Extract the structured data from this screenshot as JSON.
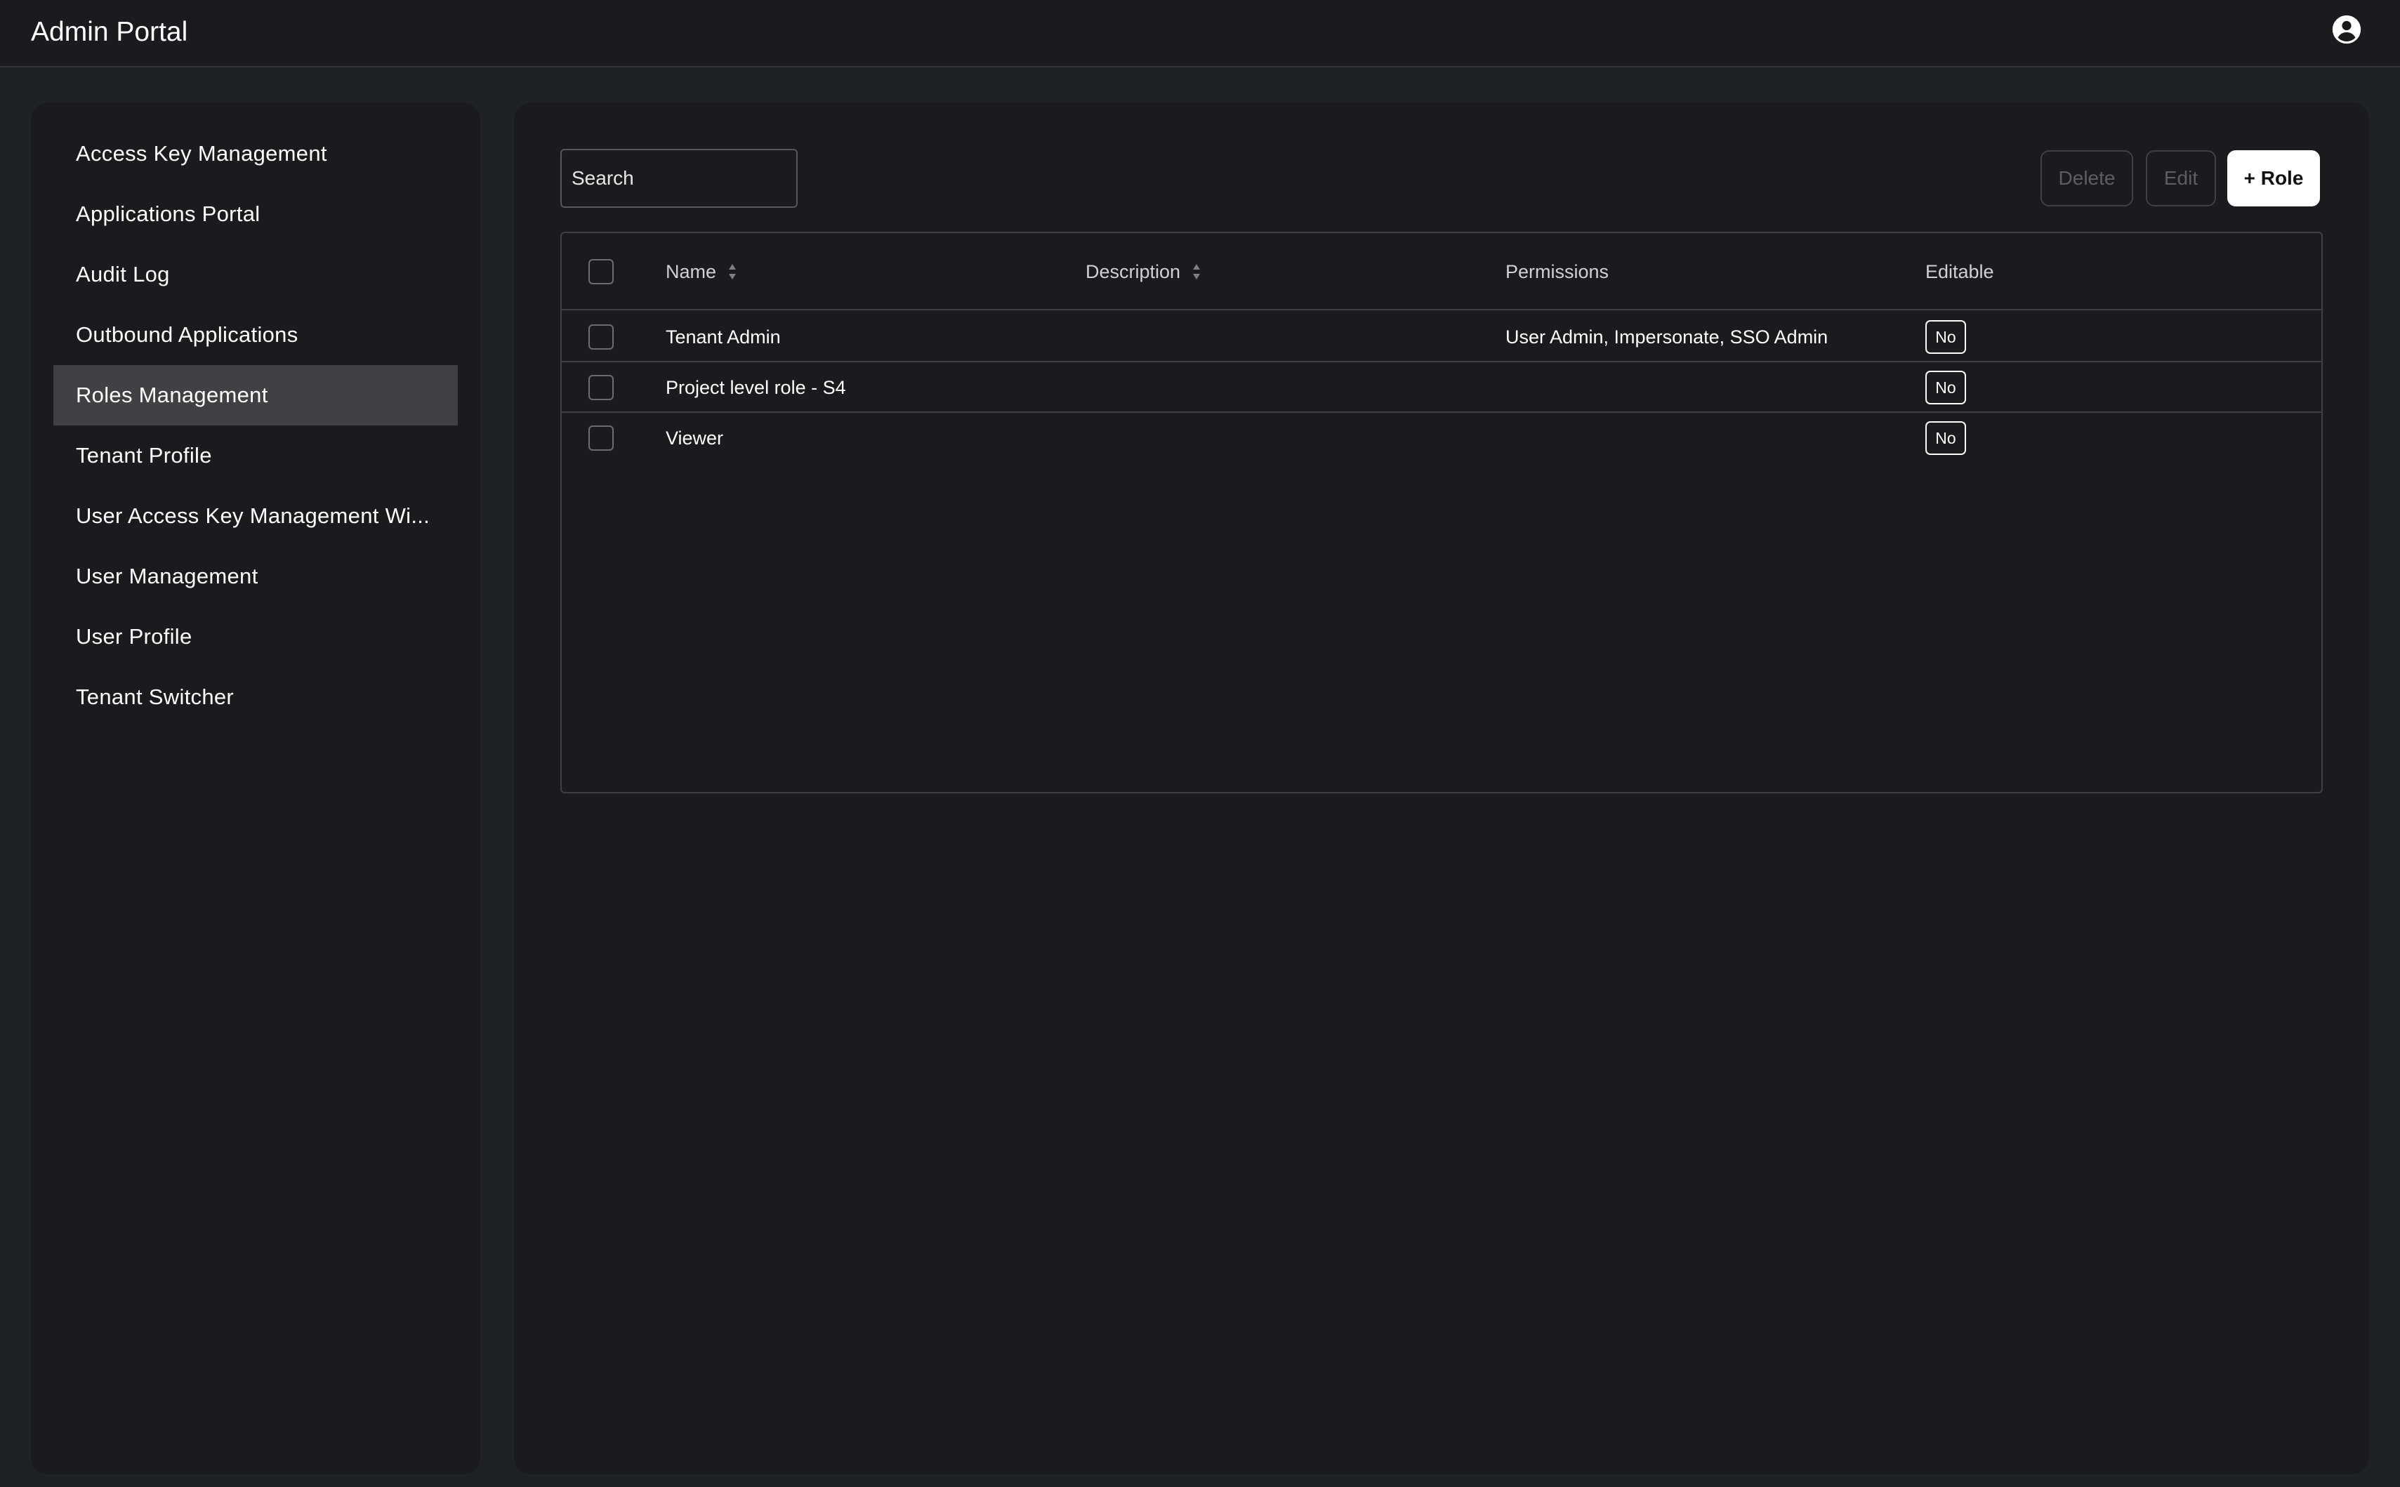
{
  "header": {
    "title": "Admin Portal",
    "account_icon": "account-circle-icon"
  },
  "sidebar": {
    "items": [
      {
        "label": "Access Key Management",
        "active": false
      },
      {
        "label": "Applications Portal",
        "active": false
      },
      {
        "label": "Audit Log",
        "active": false
      },
      {
        "label": "Outbound Applications",
        "active": false
      },
      {
        "label": "Roles Management",
        "active": true
      },
      {
        "label": "Tenant Profile",
        "active": false
      },
      {
        "label": "User Access Key Management Wi...",
        "active": false
      },
      {
        "label": "User Management",
        "active": false
      },
      {
        "label": "User Profile",
        "active": false
      },
      {
        "label": "Tenant Switcher",
        "active": false
      }
    ]
  },
  "toolbar": {
    "search_placeholder": "Search",
    "search_value": "",
    "delete_label": "Delete",
    "edit_label": "Edit",
    "add_label": "+ Role"
  },
  "table": {
    "columns": {
      "name": "Name",
      "description": "Description",
      "permissions": "Permissions",
      "editable": "Editable"
    },
    "rows": [
      {
        "name": "Tenant Admin",
        "description": "",
        "permissions": "User Admin, Impersonate, SSO Admin",
        "editable": "No"
      },
      {
        "name": "Project level role - S4",
        "description": "",
        "permissions": "",
        "editable": "No"
      },
      {
        "name": "Viewer",
        "description": "",
        "permissions": "",
        "editable": "No"
      }
    ]
  },
  "colors": {
    "background": "#1f2225",
    "panel": "#1a1b1e",
    "active_nav": "#3f4144",
    "border": "#3d4044",
    "text": "#ffffff",
    "primary_button": "#ffffff"
  }
}
